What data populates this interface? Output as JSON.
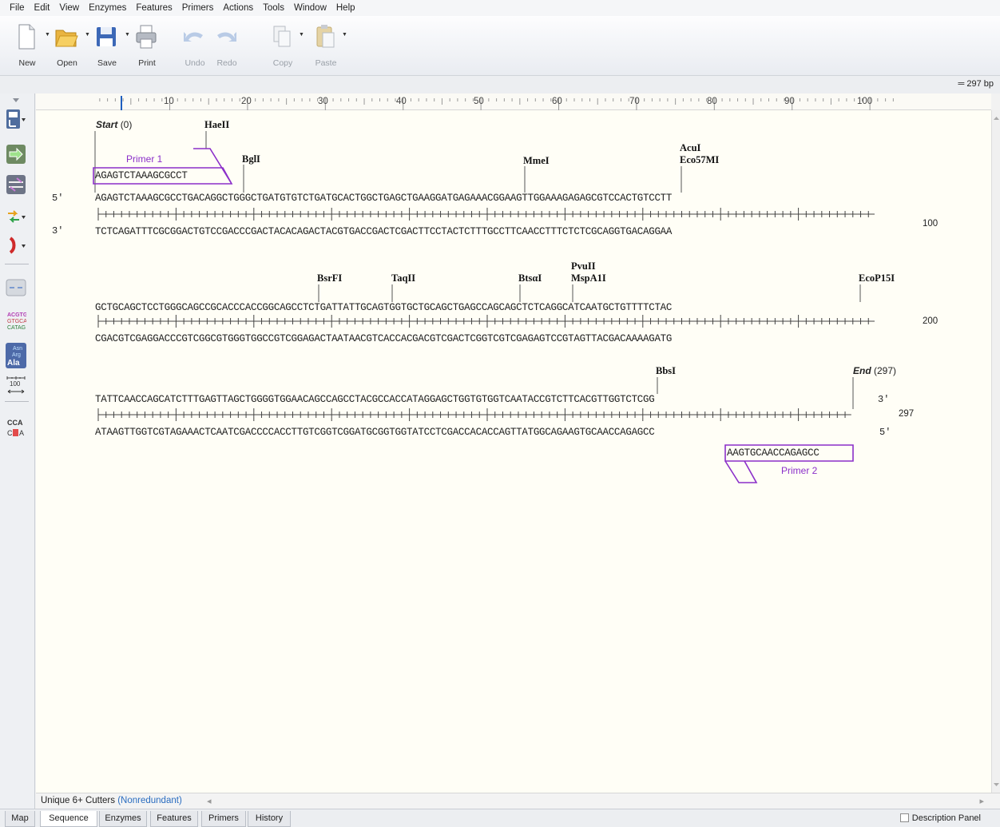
{
  "menubar": [
    "File",
    "Edit",
    "View",
    "Enzymes",
    "Features",
    "Primers",
    "Actions",
    "Tools",
    "Window",
    "Help"
  ],
  "toolbar": {
    "new": "New",
    "open": "Open",
    "save": "Save",
    "print": "Print",
    "undo": "Undo",
    "redo": "Redo",
    "copy": "Copy",
    "paste": "Paste"
  },
  "length_label": "297 bp",
  "ruler_labels": [
    "10",
    "20",
    "30",
    "40",
    "50",
    "60",
    "70",
    "80",
    "90",
    "100"
  ],
  "strand_labels": {
    "five": "5′",
    "three": "3′"
  },
  "start_label": {
    "word": "Start",
    "value": "(0)"
  },
  "end_label": {
    "word": "End",
    "value": "(297)"
  },
  "rows": [
    {
      "top": "AGAGTCTAAAGCGCCTGACAGGCTGGGCTGATGTGTCTGATGCACTGGCTGAGCTGAAGGATGAGAAACGGAAGTTGGAAAGAGAGCGTCCACTGTCCTT",
      "bottom": "TCTCAGATTTCGCGGACTGTCCGACCCGACTACACAGACTACGTGACCGACTCGACTTCCTACTCTTTGCCTTCAACCTTTCTCTCGCAGGTGACAGGAA",
      "end_number": "100"
    },
    {
      "top": "GCTGCAGCTCCTGGGCAGCCGCACCCACCGGCAGCCTCTGATTATTGCAGTGGTGCTGCAGCTGAGCCAGCAGCTCTCAGGCATCAATGCTGTTTTCTAC",
      "bottom": "CGACGTCGAGGACCCGTCGGCGTGGGTGGCCGTCGGAGACTAATAACGTCACCACGACGTCGACTCGGTCGTCGAGAGTCCGTAGTTACGACAAAAGATG",
      "end_number": "200"
    },
    {
      "top": "TATTCAACCAGCATCTTTGAGTTAGCTGGGGTGGAACAGCCAGCCTACGCCACCATAGGAGCTGGTGTGGTCAATACCGTCTTCACGTTGGTCTCGG",
      "bottom": "ATAAGTTGGTCGTAGAAACTCAATCGACCCCACCTTGTCGGTCGGATGCGGTGGTATCCTCGACCACACCAGTTATGGCAGAAGTGCAACCAGAGCC",
      "end_number": "297"
    }
  ],
  "enzymes": {
    "row1": [
      "HaeII",
      "BglI",
      "MmeI",
      "AcuI",
      "Eco57MI"
    ],
    "row2": [
      "BsrFI",
      "TaqII",
      "BtsαI",
      "PvuII",
      "MspA1I",
      "EcoP15I"
    ],
    "row3": [
      "BbsI"
    ]
  },
  "primers": [
    {
      "name": "Primer 1",
      "sequence": "AGAGTCTAAAGCGCCT"
    },
    {
      "name": "Primer 2",
      "sequence": "AAGTGCAACCAGAGCC"
    }
  ],
  "enzyme_set": {
    "name": "Unique 6+ Cutters",
    "detail": "(Nonredundant)"
  },
  "tabs": [
    "Map",
    "Sequence",
    "Enzymes",
    "Features",
    "Primers",
    "History"
  ],
  "active_tab": "Sequence",
  "description_panel": "Description Panel",
  "colors": {
    "primer": "#8b2fc9",
    "canvas": "#fffef6"
  }
}
